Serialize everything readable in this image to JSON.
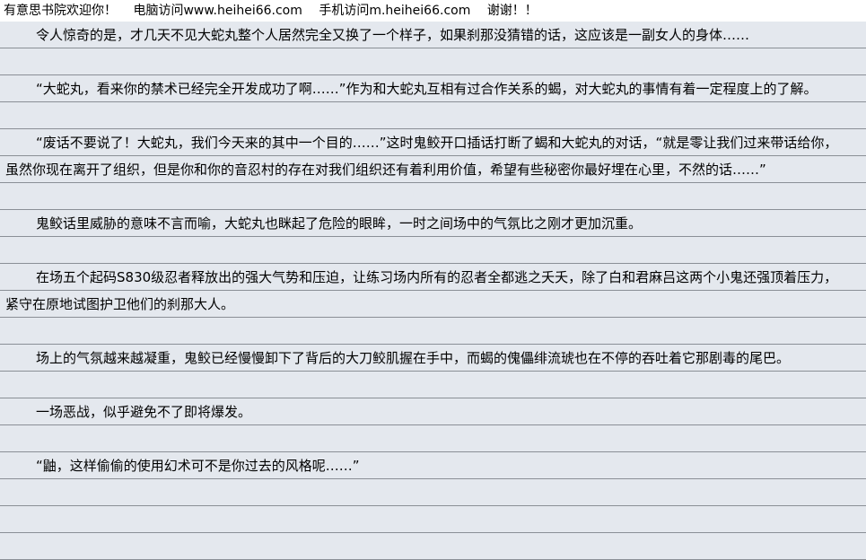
{
  "header": {
    "site_name": "有意思书院欢迎你！",
    "pc_visit": "电脑访问www.heihei66.com",
    "mobile_visit": "手机访问m.heihei66.com",
    "thanks": "谢谢！！"
  },
  "paragraphs": [
    "令人惊奇的是，才几天不见大蛇丸整个人居然完全又换了一个样子，如果刹那没猜错的话，这应该是一副女人的身体……",
    "“大蛇丸，看来你的禁术已经完全开发成功了啊……”作为和大蛇丸互相有过合作关系的蝎，对大蛇丸的事情有着一定程度上的了解。",
    "“废话不要说了！大蛇丸，我们今天来的其中一个目的……”这时鬼鲛开口插话打断了蝎和大蛇丸的对话，“就是零让我们过来带话给你，虽然你现在离开了组织，但是你和你的音忍村的存在对我们组织还有着利用价值，希望有些秘密你最好埋在心里，不然的话……”",
    "鬼鲛话里威胁的意味不言而喻，大蛇丸也眯起了危险的眼眸，一时之间场中的气氛比之刚才更加沉重。",
    "在场五个起码S830级忍者释放出的强大气势和压迫，让练习场内所有的忍者全都逃之夭夭，除了白和君麻吕这两个小鬼还强顶着压力，紧守在原地试图护卫他们的刹那大人。",
    "场上的气氛越来越凝重，鬼鲛已经慢慢卸下了背后的大刀鲛肌握在手中，而蝎的傀儡绯流琥也在不停的吞吐着它那剧毒的尾巴。",
    "一场恶战，似乎避免不了即将爆发。",
    "“鼬，这样偷偷的使用幻术可不是你过去的风格呢……”"
  ]
}
